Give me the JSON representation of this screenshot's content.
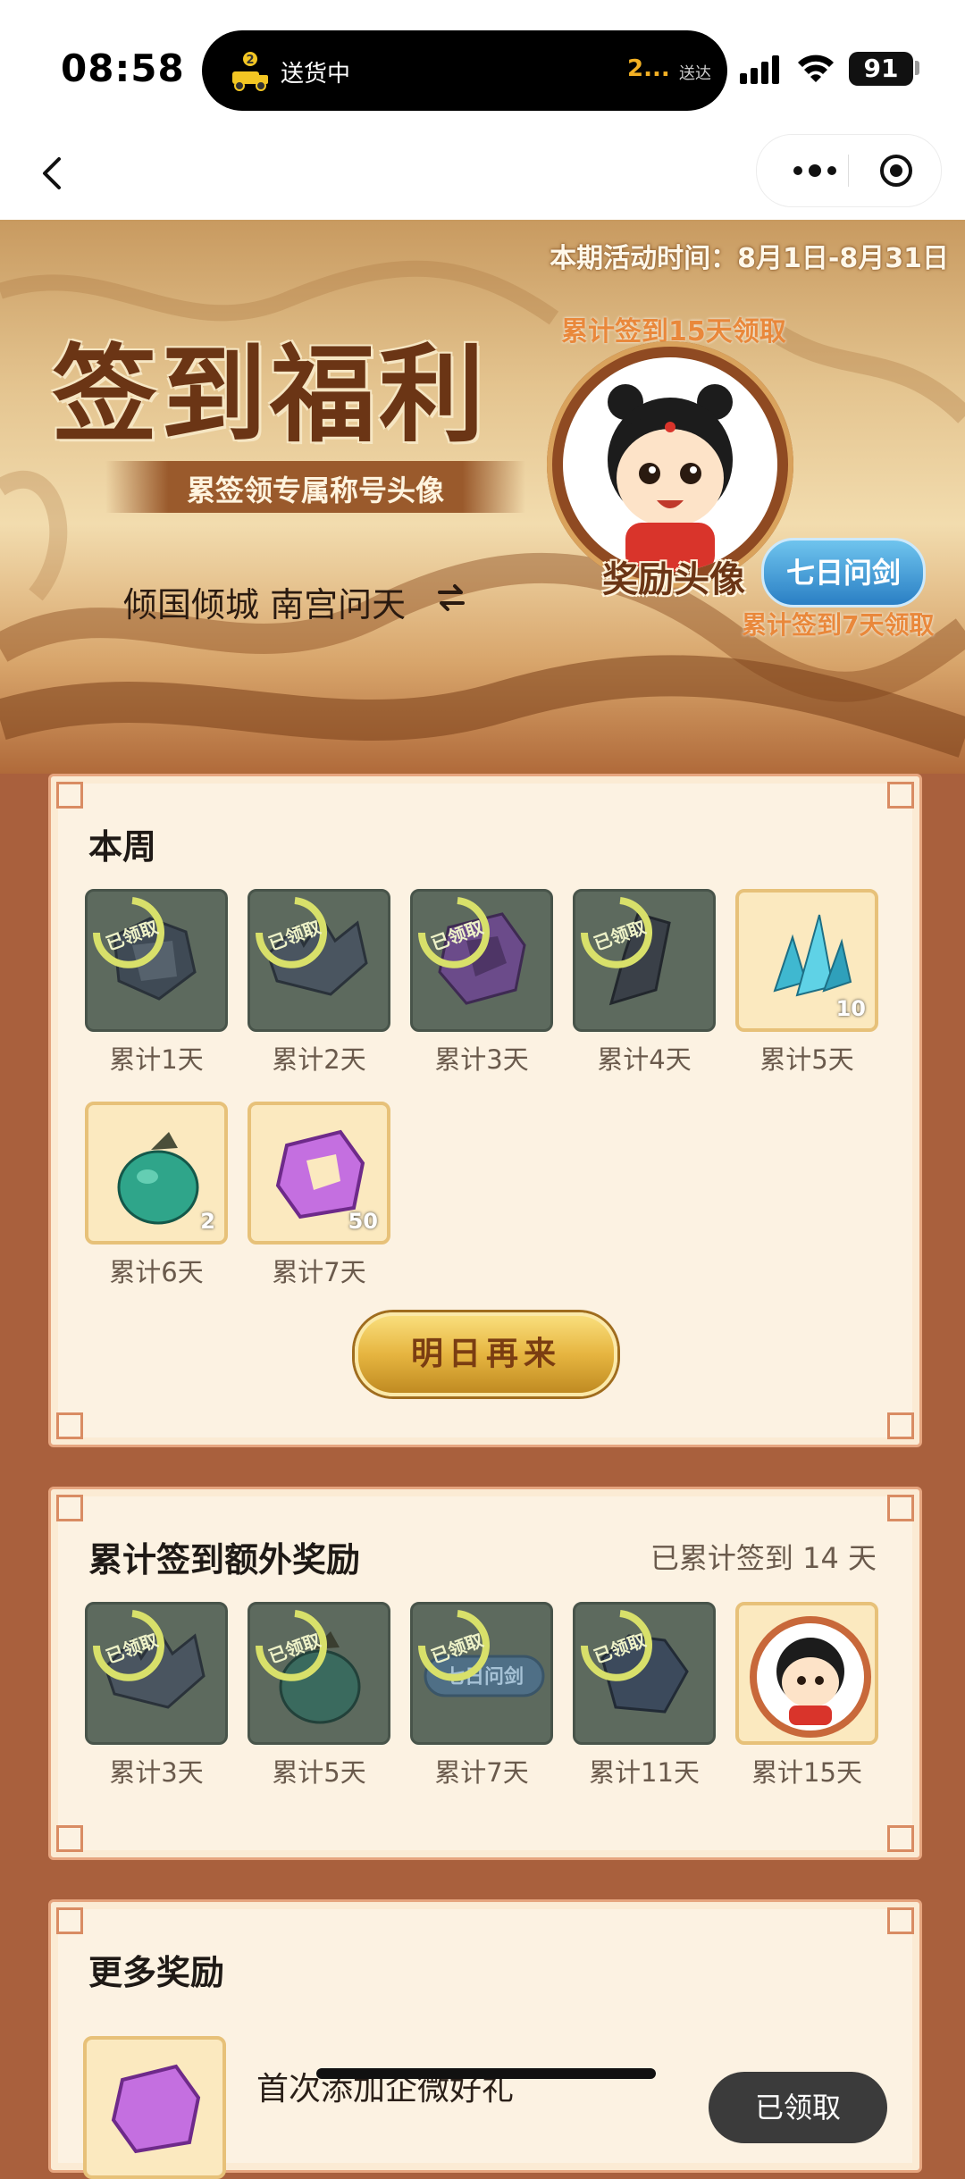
{
  "status_bar": {
    "time": "08:58",
    "live_activity": {
      "text": "送货中",
      "eta": "2...",
      "arrive": "送达"
    },
    "battery": "91"
  },
  "nav": {
    "back_icon": "back-chevron-icon",
    "more_icon": "more-icon",
    "record_icon": "record-icon"
  },
  "hero": {
    "period": "本期活动时间：8月1日-8月31日",
    "title": "签到福利",
    "subtitle": "累签领专属称号头像",
    "server": "倾国倾城  南宫问天",
    "top_note": "累计签到15天领取",
    "reward_label": "奖励头像",
    "title_badge": "七日问剑",
    "badge_note": "累计签到7天领取"
  },
  "week": {
    "title": "本周",
    "items": [
      {
        "label": "累计1天",
        "status": "已领取",
        "claimed": true
      },
      {
        "label": "累计2天",
        "status": "已领取",
        "claimed": true
      },
      {
        "label": "累计3天",
        "status": "已领取",
        "claimed": true
      },
      {
        "label": "累计4天",
        "status": "已领取",
        "claimed": true
      },
      {
        "label": "累计5天",
        "qty": "10",
        "claimed": false
      },
      {
        "label": "累计6天",
        "qty": "2",
        "claimed": false
      },
      {
        "label": "累计7天",
        "qty": "50",
        "claimed": false
      }
    ],
    "button": "明日再来"
  },
  "cumulative": {
    "title": "累计签到额外奖励",
    "summary": "已累计签到 14 天",
    "items": [
      {
        "label": "累计3天",
        "status": "已领取",
        "claimed": true
      },
      {
        "label": "累计5天",
        "status": "已领取",
        "claimed": true
      },
      {
        "label": "累计7天",
        "status": "已领取",
        "claimed": true,
        "badge": "七日问剑"
      },
      {
        "label": "累计11天",
        "status": "已领取",
        "claimed": true
      },
      {
        "label": "累计15天",
        "claimed": false
      }
    ]
  },
  "more": {
    "title": "更多奖励",
    "item_text": "首次添加企微好礼",
    "button": "已领取"
  }
}
